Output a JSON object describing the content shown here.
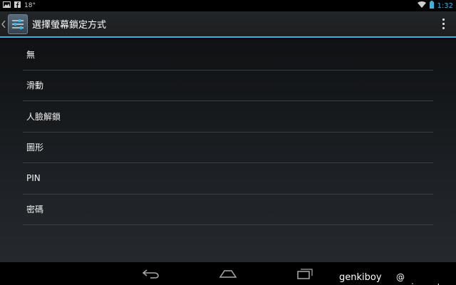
{
  "status_bar": {
    "temperature": "18°",
    "time": "1:32",
    "icons": [
      "image-icon",
      "facebook-icon",
      "wifi-icon",
      "battery-icon"
    ]
  },
  "action_bar": {
    "title": "選擇螢幕鎖定方式",
    "icon": "settings-sliders-icon"
  },
  "options": [
    {
      "label": "無"
    },
    {
      "label": "滑動"
    },
    {
      "label": "人臉解鎖"
    },
    {
      "label": "圖形"
    },
    {
      "label": "PIN"
    },
    {
      "label": "密碼"
    }
  ],
  "nav_bar": {
    "icons": [
      "back-icon",
      "home-icon",
      "recents-icon"
    ]
  },
  "watermark": {
    "user": "genkiboy",
    "site": "@ sogi.com.tw"
  },
  "colors": {
    "accent": "#33b5e5",
    "divider": "#3a3e42"
  }
}
